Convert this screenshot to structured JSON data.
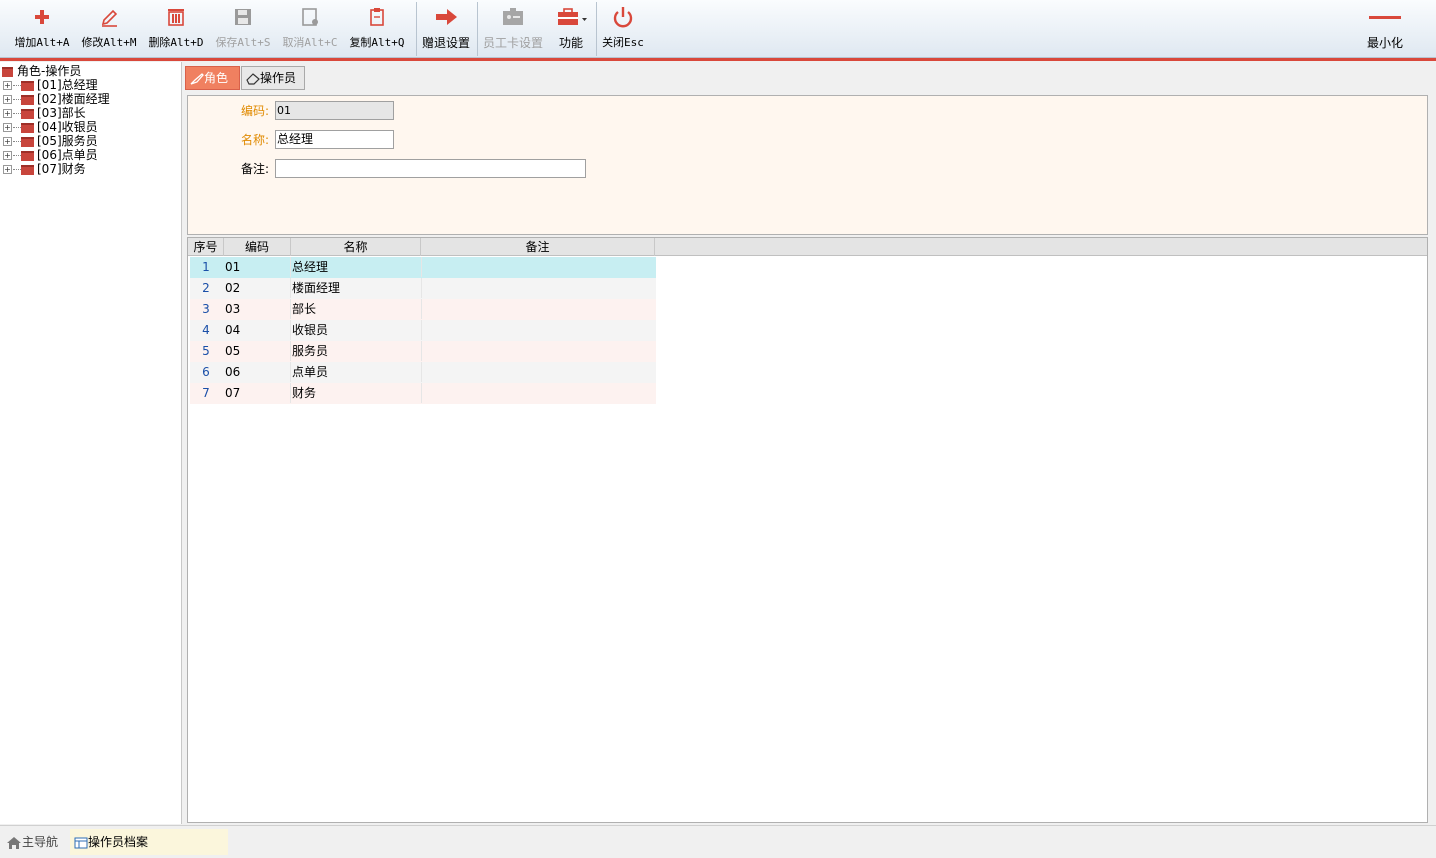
{
  "toolbar": {
    "add": "增加Alt+A",
    "edit": "修改Alt+M",
    "delete": "删除Alt+D",
    "save": "保存Alt+S",
    "cancel": "取消Alt+C",
    "copy": "复制Alt+Q",
    "gift": "赠退设置",
    "card": "员工卡设置",
    "func": "功能",
    "close": "关闭Esc",
    "minimize": "最小化"
  },
  "tree": {
    "root": "角色-操作员",
    "items": [
      "[01]总经理",
      "[02]楼面经理",
      "[03]部长",
      "[04]收银员",
      "[05]服务员",
      "[06]点单员",
      "[07]财务"
    ]
  },
  "tabs": {
    "role": "角色",
    "operator": "操作员"
  },
  "form": {
    "code_label": "编码:",
    "code_value": "01",
    "name_label": "名称:",
    "name_value": "总经理",
    "note_label": "备注:",
    "note_value": ""
  },
  "grid": {
    "headers": [
      "序号",
      "编码",
      "名称",
      "备注"
    ],
    "rows": [
      {
        "no": "1",
        "code": "01",
        "name": "总经理",
        "note": ""
      },
      {
        "no": "2",
        "code": "02",
        "name": "楼面经理",
        "note": ""
      },
      {
        "no": "3",
        "code": "03",
        "name": "部长",
        "note": ""
      },
      {
        "no": "4",
        "code": "04",
        "name": "收银员",
        "note": ""
      },
      {
        "no": "5",
        "code": "05",
        "name": "服务员",
        "note": ""
      },
      {
        "no": "6",
        "code": "06",
        "name": "点单员",
        "note": ""
      },
      {
        "no": "7",
        "code": "07",
        "name": "财务",
        "note": ""
      }
    ]
  },
  "statusbar": {
    "home": "主导航",
    "current": "操作员档案"
  },
  "colors": {
    "accent": "#d9483b",
    "selected_row": "#c7eef2",
    "row_alt_a": "#fdf2f0",
    "row_alt_b": "#f4f4f4"
  }
}
